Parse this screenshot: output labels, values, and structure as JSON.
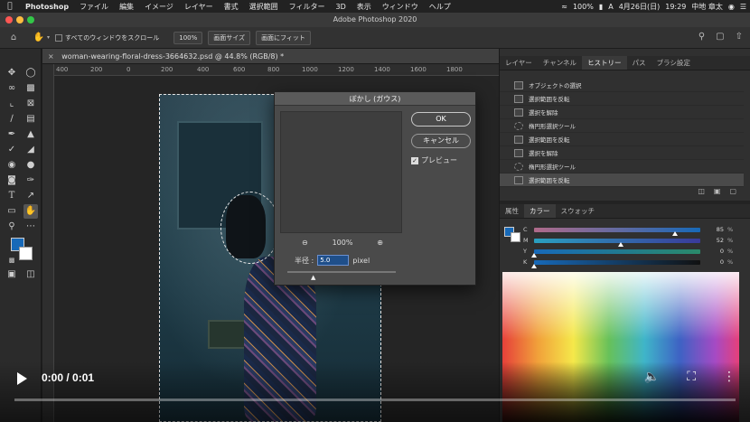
{
  "menubar": {
    "app_name": "Photoshop",
    "items": [
      "ファイル",
      "編集",
      "イメージ",
      "レイヤー",
      "書式",
      "選択範囲",
      "フィルター",
      "3D",
      "表示",
      "ウィンドウ",
      "ヘルプ"
    ],
    "battery": "100%",
    "input_mode": "A",
    "date": "4月26日(日)",
    "time": "19:29",
    "user": "中地 章太"
  },
  "window": {
    "title": "Adobe Photoshop 2020",
    "traffic_colors": [
      "#fc5753",
      "#fdbc40",
      "#33c748"
    ]
  },
  "options": {
    "scroll_all_label": "すべてのウィンドウをスクロール",
    "zoom_value": "100%",
    "fit_screen_label": "画面サイズ",
    "fill_screen_label": "画面にフィット"
  },
  "document": {
    "tab_title": "woman-wearing-floral-dress-3664632.psd @ 44.8% (RGB/8) *",
    "ruler_ticks": [
      "400",
      "200",
      "0",
      "200",
      "400",
      "600",
      "800",
      "1000",
      "1200",
      "1400",
      "1600",
      "1800"
    ]
  },
  "dialog": {
    "title": "ぼかし (ガウス)",
    "ok_label": "OK",
    "cancel_label": "キャンセル",
    "preview_label": "プレビュー",
    "preview_checked": true,
    "zoom_value": "100%",
    "radius_label": "半径 :",
    "radius_value": "5.0",
    "radius_unit": "pixel"
  },
  "top_panel": {
    "tabs": [
      "レイヤー",
      "チャンネル",
      "ヒストリー",
      "パス",
      "ブラシ設定"
    ],
    "active_tab": "ヒストリー",
    "history": [
      {
        "label": "オブジェクトの選択",
        "icon": "doc-icon"
      },
      {
        "label": "選択範囲を反転",
        "icon": "doc-icon"
      },
      {
        "label": "選択を解除",
        "icon": "doc-icon"
      },
      {
        "label": "楕円形選択ツール",
        "icon": "ellipse-icon"
      },
      {
        "label": "選択範囲を反転",
        "icon": "doc-icon"
      },
      {
        "label": "選択を解除",
        "icon": "doc-icon"
      },
      {
        "label": "楕円形選択ツール",
        "icon": "ellipse-icon"
      },
      {
        "label": "選択範囲を反転",
        "icon": "doc-icon"
      }
    ],
    "selected_index": 7
  },
  "bottom_panel": {
    "tabs": [
      "属性",
      "カラー",
      "スウォッチ"
    ],
    "active_tab": "カラー",
    "cmyk": [
      {
        "channel": "C",
        "value": "85",
        "level": 0.85
      },
      {
        "channel": "M",
        "value": "52",
        "level": 0.52
      },
      {
        "channel": "Y",
        "value": "0",
        "level": 0.0
      },
      {
        "channel": "K",
        "value": "0",
        "level": 0.0
      }
    ],
    "percent_sign": "%",
    "foreground_color": "#1769b8",
    "background_color": "#ffffff"
  },
  "video": {
    "time": "0:00 / 0:01"
  }
}
